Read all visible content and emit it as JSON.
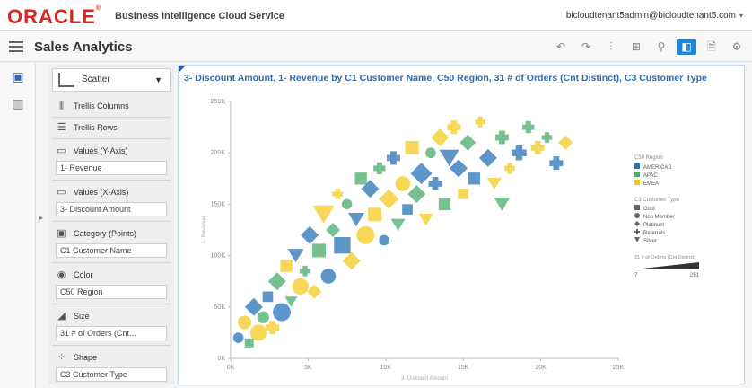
{
  "header": {
    "logo_text": "ORACLE",
    "logo_reg": "®",
    "product": "Business Intelligence Cloud Service",
    "user": "bicloudtenant5admin@bicloudtenant5.com",
    "user_caret": "▾"
  },
  "subbar": {
    "title": "Sales Analytics",
    "tools": [
      {
        "icon": "undo-icon",
        "glyph": "↶"
      },
      {
        "icon": "redo-icon",
        "glyph": "↷"
      },
      {
        "icon": "chart-properties-icon",
        "glyph": "⫶"
      },
      {
        "icon": "data-panel-icon",
        "glyph": "⊞"
      },
      {
        "icon": "filter-icon",
        "glyph": "⚲"
      },
      {
        "icon": "presentation-icon",
        "glyph": "◧"
      },
      {
        "icon": "save-icon",
        "glyph": "🗎"
      },
      {
        "icon": "settings-icon",
        "glyph": "⚙"
      }
    ]
  },
  "rail": {
    "items": [
      {
        "icon": "data-elements-icon",
        "glyph": "▣"
      },
      {
        "icon": "visualizations-icon",
        "glyph": "▥"
      }
    ]
  },
  "panel": {
    "chart_type": "Scatter",
    "trellis_columns": "Trellis Columns",
    "trellis_rows": "Trellis Rows",
    "values_y_label": "Values (Y-Axis)",
    "values_y_value": "1- Revenue",
    "values_x_label": "Values (X-Axis)",
    "values_x_value": "3- Discount Amount",
    "category_label": "Category (Points)",
    "category_value": "C1 Customer Name",
    "color_label": "Color",
    "color_value": "C50 Region",
    "size_label": "Size",
    "size_value": "31 # of Orders (Cnt...",
    "shape_label": "Shape",
    "shape_value": "C3 Customer Type"
  },
  "chart_title": "3- Discount Amount, 1- Revenue by C1 Customer Name, C50 Region, 31 # of Orders (Cnt Distinct), C3 Customer Type",
  "colors": {
    "AMERICAS": "#2a73b8",
    "APAC": "#4bab6a",
    "EMEA": "#f3c91f",
    "accent": "#1e88d4",
    "logo": "#e0231c"
  },
  "chart_data": {
    "type": "scatter",
    "x_ticks": [
      "0K",
      "5K",
      "10K",
      "15K",
      "20K",
      "25K"
    ],
    "y_ticks": [
      "0K",
      "50K",
      "100K",
      "150K",
      "200K",
      "250K"
    ],
    "xlim": [
      0,
      25000
    ],
    "ylim": [
      0,
      250000
    ],
    "xlabel": "3- Discount Amount",
    "ylabel": "1- Revenue",
    "legend": {
      "color_title": "C50 Region",
      "color_items": [
        "AMERICAS",
        "APAC",
        "EMEA"
      ],
      "shape_title": "C3 Customer Type",
      "shape_items": [
        {
          "label": "Gold",
          "shape": "square"
        },
        {
          "label": "Non Member",
          "shape": "circle"
        },
        {
          "label": "Platinum",
          "shape": "diamond"
        },
        {
          "label": "Referrals",
          "shape": "cross"
        },
        {
          "label": "Silver",
          "shape": "triangle"
        }
      ],
      "size_title": "31 # of Orders (Cnt Distinct)",
      "size_min": "7",
      "size_max": "251"
    },
    "points": [
      {
        "x": 500,
        "y": 20000,
        "region": "AMERICAS",
        "shape": "circle",
        "size": 60
      },
      {
        "x": 900,
        "y": 35000,
        "region": "EMEA",
        "shape": "circle",
        "size": 80
      },
      {
        "x": 1200,
        "y": 15000,
        "region": "APAC",
        "shape": "square",
        "size": 50
      },
      {
        "x": 1500,
        "y": 50000,
        "region": "AMERICAS",
        "shape": "diamond",
        "size": 90
      },
      {
        "x": 1800,
        "y": 25000,
        "region": "EMEA",
        "shape": "circle",
        "size": 100
      },
      {
        "x": 2100,
        "y": 40000,
        "region": "APAC",
        "shape": "circle",
        "size": 70
      },
      {
        "x": 2400,
        "y": 60000,
        "region": "AMERICAS",
        "shape": "square",
        "size": 60
      },
      {
        "x": 2700,
        "y": 30000,
        "region": "EMEA",
        "shape": "cross",
        "size": 80
      },
      {
        "x": 3000,
        "y": 75000,
        "region": "APAC",
        "shape": "diamond",
        "size": 90
      },
      {
        "x": 3300,
        "y": 45000,
        "region": "AMERICAS",
        "shape": "circle",
        "size": 110
      },
      {
        "x": 3600,
        "y": 90000,
        "region": "EMEA",
        "shape": "square",
        "size": 70
      },
      {
        "x": 3900,
        "y": 55000,
        "region": "APAC",
        "shape": "triangle",
        "size": 60
      },
      {
        "x": 4200,
        "y": 100000,
        "region": "AMERICAS",
        "shape": "triangle",
        "size": 80
      },
      {
        "x": 4500,
        "y": 70000,
        "region": "EMEA",
        "shape": "circle",
        "size": 100
      },
      {
        "x": 4800,
        "y": 85000,
        "region": "APAC",
        "shape": "cross",
        "size": 60
      },
      {
        "x": 5100,
        "y": 120000,
        "region": "AMERICAS",
        "shape": "diamond",
        "size": 90
      },
      {
        "x": 5400,
        "y": 65000,
        "region": "EMEA",
        "shape": "diamond",
        "size": 70
      },
      {
        "x": 5700,
        "y": 105000,
        "region": "APAC",
        "shape": "square",
        "size": 80
      },
      {
        "x": 6000,
        "y": 140000,
        "region": "EMEA",
        "shape": "triangle",
        "size": 110
      },
      {
        "x": 6300,
        "y": 80000,
        "region": "AMERICAS",
        "shape": "circle",
        "size": 90
      },
      {
        "x": 6600,
        "y": 125000,
        "region": "APAC",
        "shape": "diamond",
        "size": 70
      },
      {
        "x": 6900,
        "y": 160000,
        "region": "EMEA",
        "shape": "cross",
        "size": 60
      },
      {
        "x": 7200,
        "y": 110000,
        "region": "AMERICAS",
        "shape": "square",
        "size": 100
      },
      {
        "x": 7500,
        "y": 150000,
        "region": "APAC",
        "shape": "circle",
        "size": 60
      },
      {
        "x": 7800,
        "y": 95000,
        "region": "EMEA",
        "shape": "diamond",
        "size": 90
      },
      {
        "x": 8100,
        "y": 135000,
        "region": "AMERICAS",
        "shape": "triangle",
        "size": 80
      },
      {
        "x": 8400,
        "y": 175000,
        "region": "APAC",
        "shape": "square",
        "size": 70
      },
      {
        "x": 8700,
        "y": 120000,
        "region": "EMEA",
        "shape": "circle",
        "size": 110
      },
      {
        "x": 9000,
        "y": 165000,
        "region": "AMERICAS",
        "shape": "diamond",
        "size": 90
      },
      {
        "x": 9300,
        "y": 140000,
        "region": "EMEA",
        "shape": "square",
        "size": 80
      },
      {
        "x": 9600,
        "y": 185000,
        "region": "APAC",
        "shape": "cross",
        "size": 70
      },
      {
        "x": 9900,
        "y": 115000,
        "region": "AMERICAS",
        "shape": "circle",
        "size": 60
      },
      {
        "x": 10200,
        "y": 155000,
        "region": "EMEA",
        "shape": "diamond",
        "size": 100
      },
      {
        "x": 10500,
        "y": 195000,
        "region": "AMERICAS",
        "shape": "cross",
        "size": 80
      },
      {
        "x": 10800,
        "y": 130000,
        "region": "APAC",
        "shape": "triangle",
        "size": 70
      },
      {
        "x": 11100,
        "y": 170000,
        "region": "EMEA",
        "shape": "circle",
        "size": 90
      },
      {
        "x": 11400,
        "y": 145000,
        "region": "AMERICAS",
        "shape": "square",
        "size": 60
      },
      {
        "x": 11700,
        "y": 205000,
        "region": "EMEA",
        "shape": "square",
        "size": 80
      },
      {
        "x": 12000,
        "y": 160000,
        "region": "APAC",
        "shape": "diamond",
        "size": 90
      },
      {
        "x": 12300,
        "y": 180000,
        "region": "AMERICAS",
        "shape": "diamond",
        "size": 110
      },
      {
        "x": 12600,
        "y": 135000,
        "region": "EMEA",
        "shape": "triangle",
        "size": 70
      },
      {
        "x": 12900,
        "y": 200000,
        "region": "APAC",
        "shape": "circle",
        "size": 60
      },
      {
        "x": 13200,
        "y": 170000,
        "region": "AMERICAS",
        "shape": "cross",
        "size": 80
      },
      {
        "x": 13500,
        "y": 215000,
        "region": "EMEA",
        "shape": "diamond",
        "size": 90
      },
      {
        "x": 13800,
        "y": 150000,
        "region": "APAC",
        "shape": "square",
        "size": 70
      },
      {
        "x": 14100,
        "y": 195000,
        "region": "AMERICAS",
        "shape": "triangle",
        "size": 100
      },
      {
        "x": 14400,
        "y": 225000,
        "region": "EMEA",
        "shape": "cross",
        "size": 80
      },
      {
        "x": 14700,
        "y": 185000,
        "region": "AMERICAS",
        "shape": "diamond",
        "size": 90
      },
      {
        "x": 15000,
        "y": 160000,
        "region": "EMEA",
        "shape": "square",
        "size": 60
      },
      {
        "x": 15300,
        "y": 210000,
        "region": "APAC",
        "shape": "diamond",
        "size": 80
      },
      {
        "x": 15700,
        "y": 175000,
        "region": "AMERICAS",
        "shape": "square",
        "size": 70
      },
      {
        "x": 16100,
        "y": 230000,
        "region": "EMEA",
        "shape": "cross",
        "size": 60
      },
      {
        "x": 16600,
        "y": 195000,
        "region": "AMERICAS",
        "shape": "diamond",
        "size": 90
      },
      {
        "x": 17000,
        "y": 170000,
        "region": "EMEA",
        "shape": "triangle",
        "size": 70
      },
      {
        "x": 17500,
        "y": 215000,
        "region": "APAC",
        "shape": "cross",
        "size": 80
      },
      {
        "x": 18000,
        "y": 185000,
        "region": "EMEA",
        "shape": "cross",
        "size": 60
      },
      {
        "x": 18600,
        "y": 200000,
        "region": "AMERICAS",
        "shape": "cross",
        "size": 90
      },
      {
        "x": 19200,
        "y": 225000,
        "region": "APAC",
        "shape": "cross",
        "size": 70
      },
      {
        "x": 19800,
        "y": 205000,
        "region": "EMEA",
        "shape": "cross",
        "size": 80
      },
      {
        "x": 20400,
        "y": 215000,
        "region": "APAC",
        "shape": "cross",
        "size": 60
      },
      {
        "x": 21000,
        "y": 190000,
        "region": "AMERICAS",
        "shape": "cross",
        "size": 80
      },
      {
        "x": 21600,
        "y": 210000,
        "region": "EMEA",
        "shape": "diamond",
        "size": 70
      },
      {
        "x": 17500,
        "y": 150000,
        "region": "APAC",
        "shape": "triangle",
        "size": 80
      }
    ]
  }
}
